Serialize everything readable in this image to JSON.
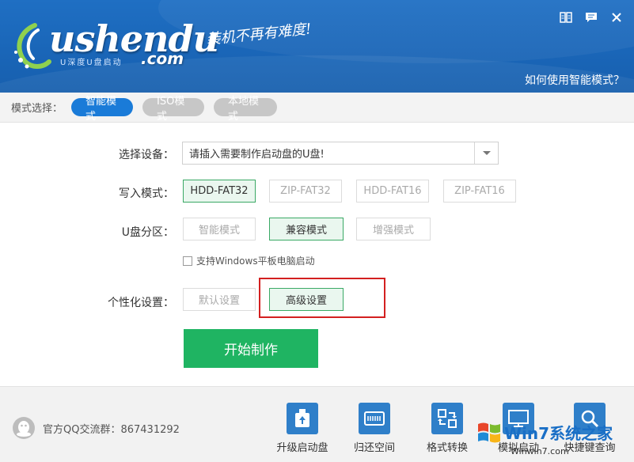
{
  "header": {
    "logo_text": "ushendu",
    "logo_sub": "U深度U盘启动",
    "logo_com": ".com",
    "slogan": "装机不再有难度!",
    "help_link": "如何使用智能模式？"
  },
  "mode_bar": {
    "label": "模式选择：",
    "tabs": [
      {
        "label": "智能模式",
        "active": true
      },
      {
        "label": "ISO模式",
        "active": false
      },
      {
        "label": "本地模式",
        "active": false
      }
    ]
  },
  "device": {
    "label": "选择设备：",
    "value": "请插入需要制作启动盘的U盘!"
  },
  "write_mode": {
    "label": "写入模式：",
    "options": [
      {
        "label": "HDD-FAT32",
        "selected": true
      },
      {
        "label": "ZIP-FAT32",
        "selected": false
      },
      {
        "label": "HDD-FAT16",
        "selected": false
      },
      {
        "label": "ZIP-FAT16",
        "selected": false
      }
    ]
  },
  "partition": {
    "label": "U盘分区：",
    "options": [
      {
        "label": "智能模式",
        "selected": false
      },
      {
        "label": "兼容模式",
        "selected": true
      },
      {
        "label": "增强模式",
        "selected": false
      }
    ],
    "checkbox_label": "支持Windows平板电脑启动",
    "checkbox_checked": false
  },
  "personalize": {
    "label": "个性化设置：",
    "options": [
      {
        "label": "默认设置",
        "selected": false
      },
      {
        "label": "高级设置",
        "selected": true
      }
    ]
  },
  "start_button": "开始制作",
  "footer": {
    "qq_text": "官方QQ交流群：867431292",
    "tools": [
      {
        "label": "升级启动盘",
        "icon": "upgrade-icon"
      },
      {
        "label": "归还空间",
        "icon": "disk-icon"
      },
      {
        "label": "格式转换",
        "icon": "convert-icon"
      },
      {
        "label": "模拟启动",
        "icon": "monitor-icon"
      },
      {
        "label": "快捷键查询",
        "icon": "search-icon"
      }
    ]
  },
  "watermark": {
    "text": "Win7系统之家",
    "sub": "Winwin7.com"
  },
  "colors": {
    "header_blue": "#1f6fc3",
    "active_tab": "#1a7bd8",
    "start_green": "#1fb462",
    "selected_border": "#3aa965",
    "highlight_red": "#d32020"
  }
}
